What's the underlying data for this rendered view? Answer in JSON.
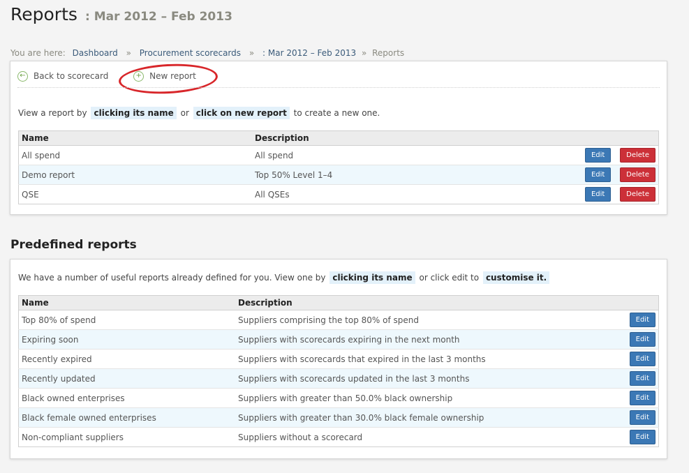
{
  "header": {
    "title": "Reports",
    "period": ": Mar 2012 – Feb 2013"
  },
  "breadcrumb": {
    "prefix": "You are here:",
    "items": [
      "Dashboard",
      "Procurement scorecards",
      ": Mar 2012 – Feb 2013"
    ],
    "current": "Reports"
  },
  "actions": {
    "back_label": "Back to scorecard",
    "new_label": "New report"
  },
  "reports": {
    "intro": {
      "part1": "View a report by",
      "kw1": "clicking its name",
      "part2": "or",
      "kw2": "click on new report",
      "part3": "to create a new one."
    },
    "columns": [
      "Name",
      "Description"
    ],
    "rows": [
      {
        "name": "All spend",
        "description": "All spend"
      },
      {
        "name": "Demo report",
        "description": "Top 50% Level 1–4"
      },
      {
        "name": "QSE",
        "description": "All QSEs"
      }
    ],
    "edit_label": "Edit",
    "delete_label": "Delete"
  },
  "predefined": {
    "title": "Predefined reports",
    "intro": {
      "part1": "We have a number of useful reports already defined for you. View one by",
      "kw1": "clicking its name",
      "part2": "or click edit to",
      "kw2": "customise it."
    },
    "columns": [
      "Name",
      "Description"
    ],
    "rows": [
      {
        "name": "Top 80% of spend",
        "description": "Suppliers comprising the top 80% of spend"
      },
      {
        "name": "Expiring soon",
        "description": "Suppliers with scorecards expiring in the next month"
      },
      {
        "name": "Recently expired",
        "description": "Suppliers with scorecards that expired in the last 3 months"
      },
      {
        "name": "Recently updated",
        "description": "Suppliers with scorecards updated in the last 3 months"
      },
      {
        "name": "Black owned enterprises",
        "description": "Suppliers with greater than 50.0% black ownership"
      },
      {
        "name": "Black female owned enterprises",
        "description": "Suppliers with greater than 30.0% black female ownership"
      },
      {
        "name": "Non-compliant suppliers",
        "description": "Suppliers without a scorecard"
      }
    ],
    "edit_label": "Edit"
  },
  "colors": {
    "edit_button": "#3b78b5",
    "delete_button": "#cc3038",
    "alt_row": "#eef8fd",
    "highlight_ring": "#d8262a"
  }
}
